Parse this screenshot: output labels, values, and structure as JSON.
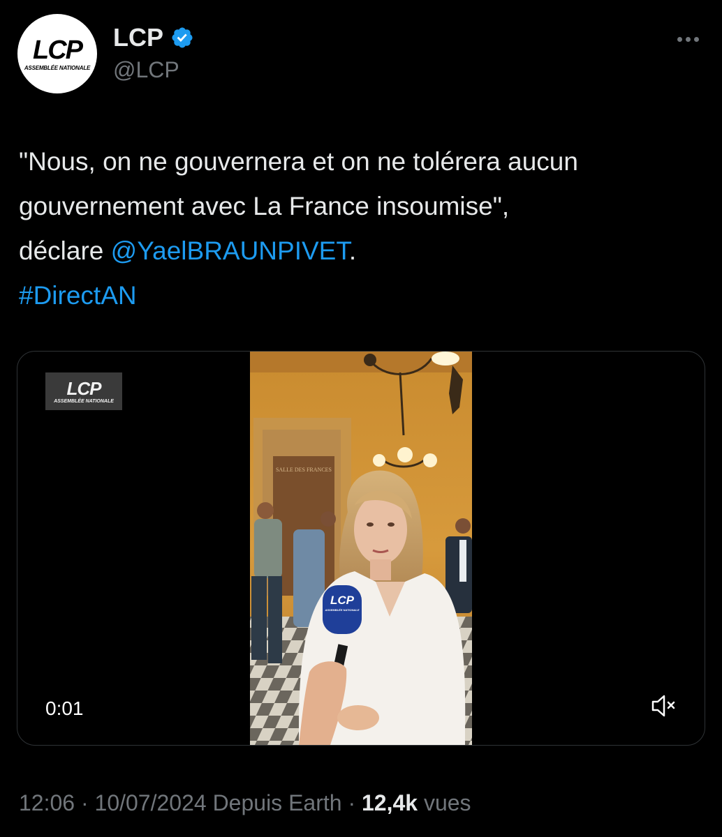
{
  "author": {
    "display_name": "LCP",
    "handle": "@LCP",
    "avatar_logo": "LCP",
    "avatar_logo_sub": "ASSEMBLÉE NATIONALE",
    "verified_color": "#1d9bf0"
  },
  "tweet": {
    "line1": "\"Nous, on ne gouvernera et on ne tolérera aucun",
    "line2": "gouvernement avec La France insoumise\",",
    "line3_prefix": "déclare ",
    "mention": "@YaelBRAUNPIVET",
    "line3_suffix": ".",
    "hashtag": "#DirectAN",
    "link_color": "#1d9bf0"
  },
  "video": {
    "watermark": "LCP",
    "watermark_sub": "ASSEMBLÉE NATIONALE",
    "elapsed": "0:01",
    "mic_logo": "LCP",
    "mic_logo_sub": "ASSEMBLÉE NATIONALE",
    "door_sign": "SALLE DES FRANCES"
  },
  "meta": {
    "time": "12:06",
    "separator": " · ",
    "date": "10/07/2024",
    "source": "Depuis Earth",
    "views_count": "12,4k",
    "views_label": "vues"
  }
}
